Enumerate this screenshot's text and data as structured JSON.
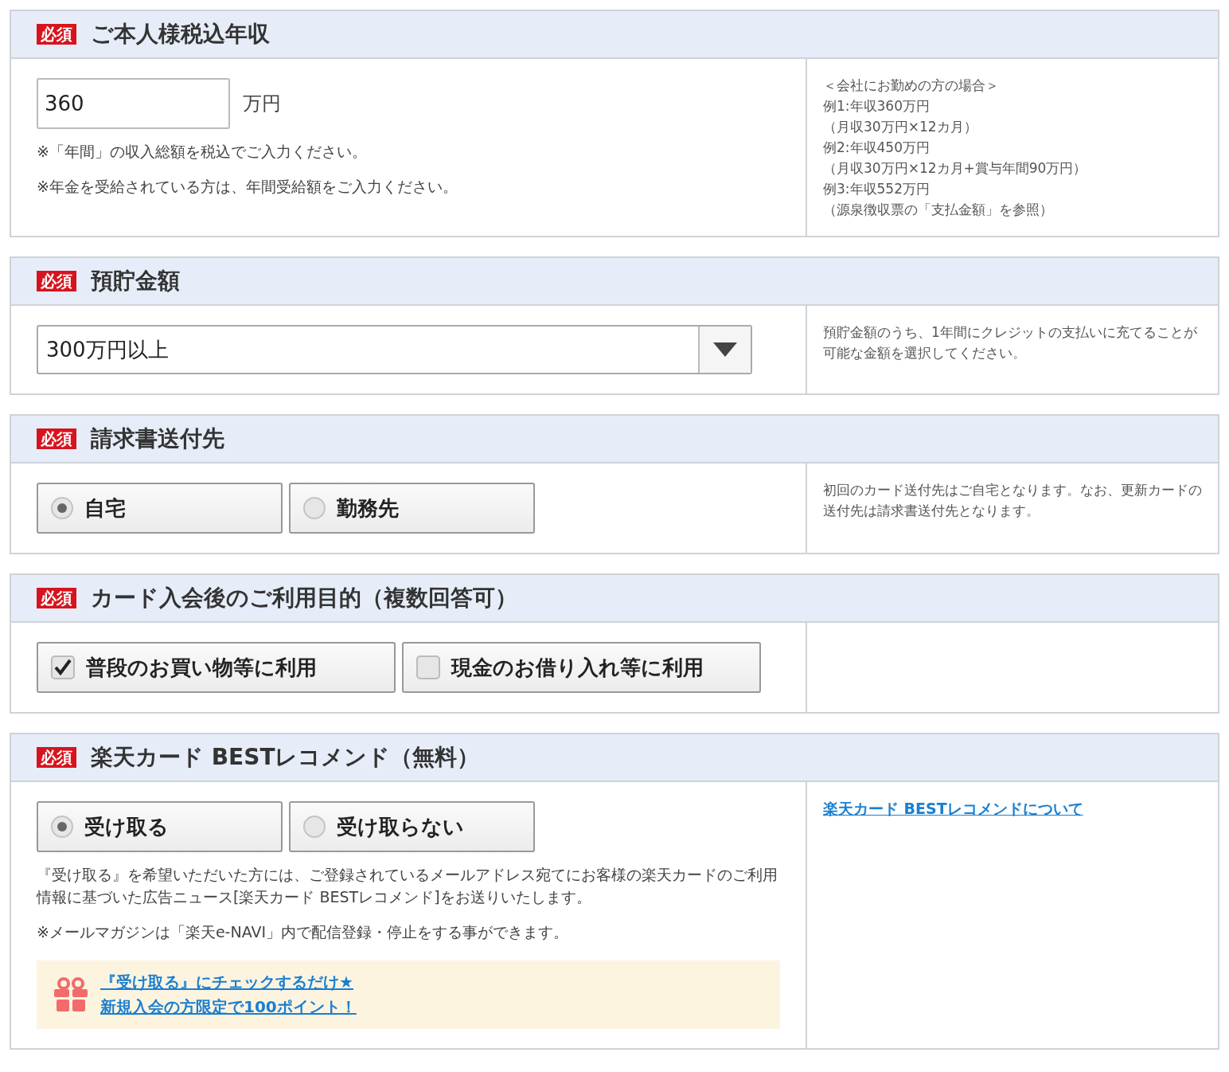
{
  "sections": [
    {
      "kind": "text_input",
      "badge": "必須",
      "title": "ご本人様税込年収",
      "value": "360",
      "unit": "万円",
      "notes": [
        "※「年間」の収入総額を税込でご入力ください。",
        "※年金を受給されている方は、年間受給額をご入力ください。"
      ],
      "aside": [
        {
          "kind": "text",
          "text": "＜会社にお勤めの方の場合＞"
        },
        {
          "kind": "text",
          "text": "例1:年収360万円"
        },
        {
          "kind": "text",
          "text": "（月収30万円×12カ月）"
        },
        {
          "kind": "text",
          "text": "例2:年収450万円"
        },
        {
          "kind": "text",
          "text": "（月収30万円×12カ月+賞与年間90万円）"
        },
        {
          "kind": "text",
          "text": "例3:年収552万円"
        },
        {
          "kind": "text",
          "text": "（源泉徴収票の「支払金額」を参照）"
        }
      ]
    },
    {
      "kind": "select",
      "badge": "必須",
      "title": "預貯金額",
      "value": "300万円以上",
      "aside": [
        {
          "kind": "text",
          "text": "預貯金額のうち、1年間にクレジットの支払いに充てることが可能な金額を選択してください。"
        }
      ]
    },
    {
      "kind": "radio",
      "badge": "必須",
      "title": "請求書送付先",
      "options": [
        {
          "label": "自宅",
          "selected": true
        },
        {
          "label": "勤務先",
          "selected": false
        }
      ],
      "aside": [
        {
          "kind": "text",
          "text": "初回のカード送付先はご自宅となります。なお、更新カードの送付先は請求書送付先となります。"
        }
      ]
    },
    {
      "kind": "checkbox",
      "badge": "必須",
      "title": "カード入会後のご利用目的（複数回答可）",
      "options": [
        {
          "label": "普段のお買い物等に利用",
          "checked": true
        },
        {
          "label": "現金のお借り入れ等に利用",
          "checked": false
        }
      ]
    },
    {
      "kind": "radio",
      "badge": "必須",
      "title": "楽天カード BESTレコメンド（無料）",
      "options": [
        {
          "label": "受け取る",
          "selected": true
        },
        {
          "label": "受け取らない",
          "selected": false
        }
      ],
      "notes": [
        "『受け取る』を希望いただいた方には、ご登録されているメールアドレス宛てにお客様の楽天カードのご利用情報に基づいた広告ニュース[楽天カード BESTレコメンド]をお送りいたします。",
        "※メールマガジンは「楽天e-NAVI」内で配信登録・停止をする事ができます。"
      ],
      "promo": [
        "『受け取る』にチェックするだけ★",
        "新規入会の方限定で100ポイント！"
      ],
      "aside": [
        {
          "kind": "link",
          "text": "楽天カード BESTレコメンドについて"
        }
      ]
    }
  ]
}
